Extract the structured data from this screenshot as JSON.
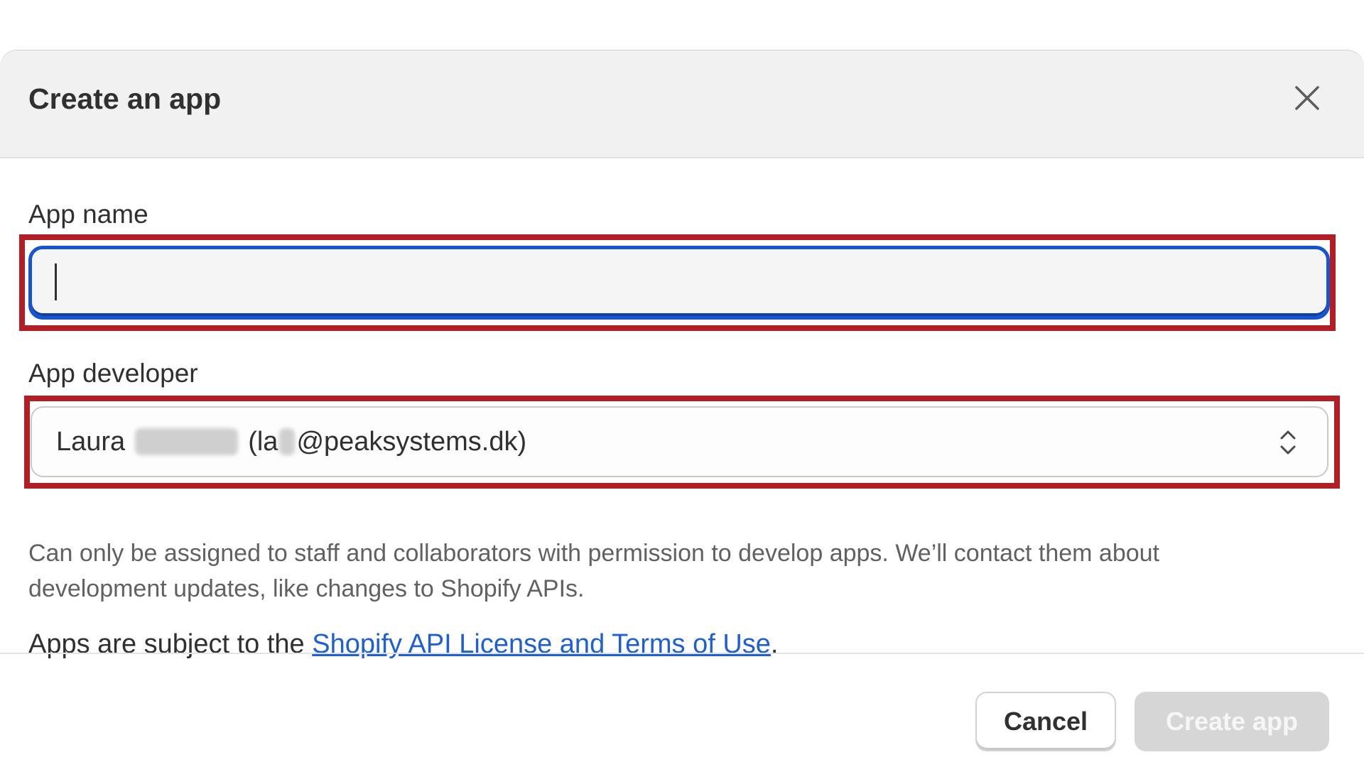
{
  "modal": {
    "title": "Create an app",
    "close_icon": "close-icon"
  },
  "app_name": {
    "label": "App name",
    "value": "",
    "placeholder": ""
  },
  "app_developer": {
    "label": "App developer",
    "first_name": "Laura",
    "email_prefix": "(la",
    "email_suffix": "@peaksystems.dk)",
    "chevron_icon": "select-chevrons-icon",
    "help_text": "Can only be assigned to staff and collaborators with permission to develop apps. We’ll contact them about development updates, like changes to Shopify APIs."
  },
  "terms": {
    "prefix": "Apps are subject to the ",
    "link_text": "Shopify API License and Terms of Use",
    "suffix": "."
  },
  "footer": {
    "cancel_label": "Cancel",
    "create_label": "Create app"
  },
  "colors": {
    "focus_border": "#1654d0",
    "highlight": "#b21e24",
    "link": "#1f5fd6",
    "disabled_button": "#d6d6d6"
  }
}
